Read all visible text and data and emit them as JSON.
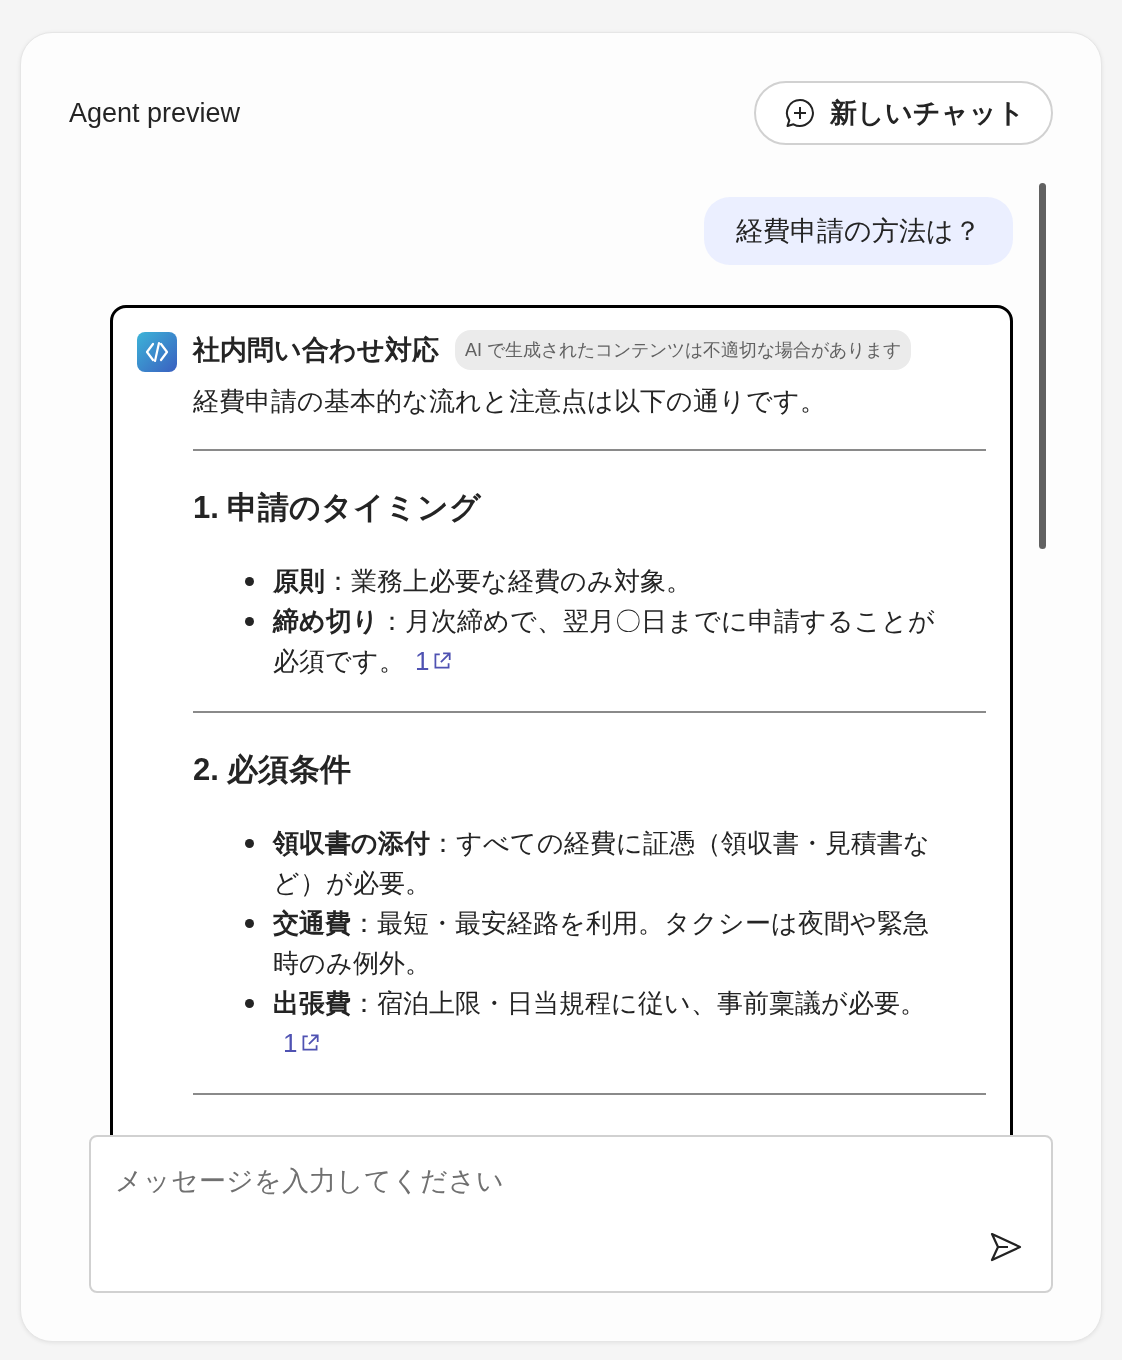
{
  "header": {
    "title": "Agent preview",
    "new_chat_button": "新しいチャット"
  },
  "user_message": "経費申請の方法は？",
  "agent": {
    "name": "社内問い合わせ対応",
    "disclaimer": "AI で生成されたコンテンツは不適切な場合があります",
    "intro": "経費申請の基本的な流れと注意点は以下の通りです。",
    "sections": [
      {
        "heading": "1. 申請のタイミング",
        "items": [
          {
            "term": "原則",
            "text": "：業務上必要な経費のみ対象。"
          },
          {
            "term": "締め切り",
            "text": "：月次締めで、翌月〇日までに申請することが必須です。",
            "citation": "1"
          }
        ]
      },
      {
        "heading": "2. 必須条件",
        "items": [
          {
            "term": "領収書の添付",
            "text": "：すべての経費に証憑（領収書・見積書など）が必要。"
          },
          {
            "term": "交通費",
            "text": "：最短・最安経路を利用。タクシーは夜間や緊急時のみ例外。"
          },
          {
            "term": "出張費",
            "text": "：宿泊上限・日当規程に従い、事前稟議が必要。",
            "citation": "1"
          }
        ]
      }
    ]
  },
  "input": {
    "placeholder": "メッセージを入力してください"
  }
}
